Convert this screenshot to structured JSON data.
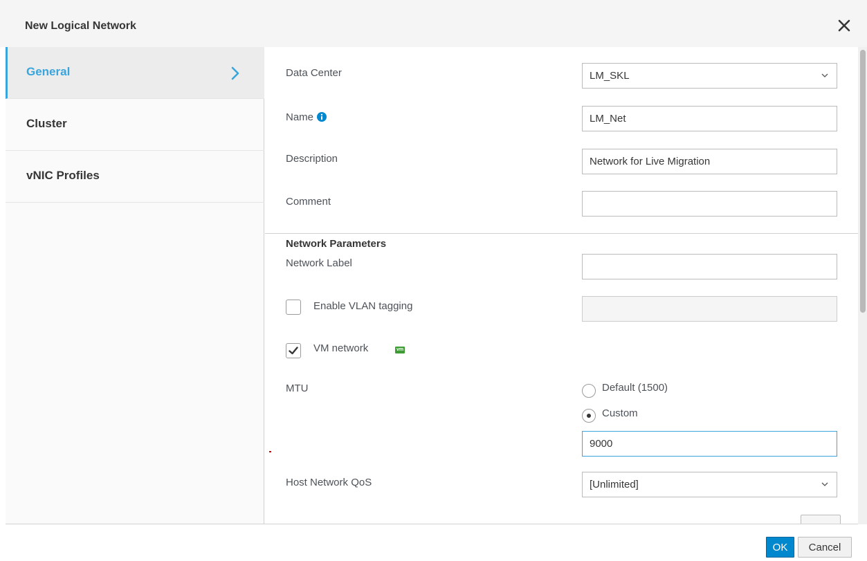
{
  "dialog": {
    "title": "New Logical Network"
  },
  "sidebar": {
    "items": [
      {
        "label": "General",
        "active": true
      },
      {
        "label": "Cluster",
        "active": false
      },
      {
        "label": "vNIC Profiles",
        "active": false
      }
    ]
  },
  "general": {
    "data_center": {
      "label": "Data Center",
      "value": "LM_SKL"
    },
    "name": {
      "label": "Name",
      "value": "LM_Net"
    },
    "description": {
      "label": "Description",
      "value": "Network for Live Migration"
    },
    "comment": {
      "label": "Comment",
      "value": ""
    }
  },
  "network_parameters": {
    "title": "Network Parameters",
    "network_label": {
      "label": "Network Label",
      "value": ""
    },
    "vlan_tagging": {
      "label": "Enable VLAN tagging",
      "checked": false,
      "value": ""
    },
    "vm_network": {
      "label": "VM network",
      "checked": true,
      "badge": "vm"
    },
    "mtu": {
      "label": "MTU",
      "options": [
        {
          "label": "Default (1500)",
          "selected": false
        },
        {
          "label": "Custom",
          "selected": true
        }
      ],
      "custom_value": "9000"
    },
    "host_network_qos": {
      "label": "Host Network QoS",
      "value": "[Unlimited]"
    }
  },
  "footer": {
    "ok_label": "OK",
    "cancel_label": "Cancel"
  },
  "colors": {
    "accent": "#39a5dc",
    "primary_button": "#0088ce",
    "vm_badge": "#3f9c35"
  }
}
